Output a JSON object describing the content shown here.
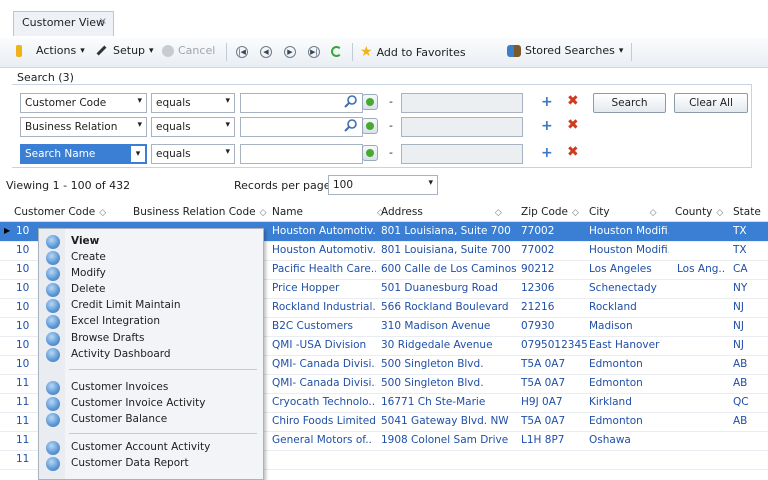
{
  "tab": {
    "title": "Customer View",
    "close": "×"
  },
  "toolbar": {
    "actions": "Actions",
    "setup": "Setup",
    "cancel": "Cancel",
    "add_favorites": "Add to Favorites",
    "stored_searches": "Stored Searches",
    "arrow": "▾",
    "nav_first": "|◀",
    "nav_prev": "◀",
    "nav_next": "▶",
    "nav_last": "▶|",
    "refresh_icon": "refresh-icon"
  },
  "search": {
    "title": "Search (3)",
    "rows": [
      {
        "field": "Customer Code",
        "operator": "equals"
      },
      {
        "field": "Business Relation",
        "operator": "equals"
      },
      {
        "field": "Search Name",
        "operator": "equals"
      }
    ],
    "dash": "-",
    "plus": "+",
    "remove": "✖",
    "search_button": "Search",
    "clear_button": "Clear All",
    "dropdown_arrow": "▾"
  },
  "info": {
    "viewing": "Viewing 1 - 100 of 432",
    "records_label": "Records per page:",
    "records_value": "100"
  },
  "grid": {
    "headers": [
      "Customer Code",
      "Business Relation Code",
      "Name",
      "Address",
      "Zip Code",
      "City",
      "County",
      "State"
    ],
    "sort_glyph": "◇",
    "left_codes": [
      "10",
      "10",
      "10",
      "10",
      "10",
      "10",
      "10",
      "10",
      "11",
      "11",
      "11",
      "11",
      "11"
    ],
    "rows": [
      {
        "name": "Houston Automotiv..",
        "address": "801 Louisiana, Suite 700",
        "zip": "77002",
        "city": "Houston Modifi..",
        "county": "",
        "state": "TX"
      },
      {
        "name": "Houston Automotiv..",
        "address": "801 Louisiana, Suite 700",
        "zip": "77002",
        "city": "Houston Modifi..",
        "county": "",
        "state": "TX"
      },
      {
        "name": "Pacific Health Care..",
        "address": "600 Calle de Los Caminos",
        "zip": "90212",
        "city": "Los Angeles",
        "county": "Los Ang..",
        "state": "CA"
      },
      {
        "name": "Price Hopper",
        "address": "501 Duanesburg Road",
        "zip": "12306",
        "city": "Schenectady",
        "county": "",
        "state": "NY"
      },
      {
        "name": "Rockland Industrial..",
        "address": "566 Rockland Boulevard",
        "zip": "21216",
        "city": "Rockland",
        "county": "",
        "state": "NJ"
      },
      {
        "name": "B2C Customers",
        "address": "310 Madison Avenue",
        "zip": "07930",
        "city": "Madison",
        "county": "",
        "state": "NJ"
      },
      {
        "name": "QMI -USA Division",
        "address": "30 Ridgedale Avenue",
        "zip": "0795012345",
        "city": "East Hanover",
        "county": "",
        "state": "NJ"
      },
      {
        "name": "QMI- Canada Divisi..",
        "address": "500 Singleton Blvd.",
        "zip": "T5A 0A7",
        "city": "Edmonton",
        "county": "",
        "state": "AB"
      },
      {
        "name": "QMI- Canada Divisi..",
        "address": "500 Singleton Blvd.",
        "zip": "T5A 0A7",
        "city": "Edmonton",
        "county": "",
        "state": "AB"
      },
      {
        "name": "Cryocath Technolo..",
        "address": "16771 Ch Ste-Marie",
        "zip": "H9J 0A7",
        "city": "Kirkland",
        "county": "",
        "state": "QC"
      },
      {
        "name": "Chiro Foods Limited",
        "address": "5041 Gateway Blvd. NW",
        "zip": "T5A 0A7",
        "city": "Edmonton",
        "county": "",
        "state": "AB"
      },
      {
        "name": "General Motors of..",
        "address": "1908 Colonel Sam Drive",
        "zip": "L1H 8P7",
        "city": "Oshawa",
        "county": "",
        "state": ""
      }
    ]
  },
  "context_menu": {
    "items": [
      "View",
      "Create",
      "Modify",
      "Delete",
      "Credit Limit Maintain",
      "Excel Integration",
      "Browse Drafts",
      "Activity Dashboard",
      "Customer Invoices",
      "Customer Invoice Activity",
      "Customer Balance",
      "Customer Account Activity",
      "Customer Data Report"
    ]
  },
  "colors": {
    "accent": "#3a7fd4",
    "link": "#1f4fa8",
    "add": "#3a78c8",
    "remove": "#d03a1f"
  }
}
